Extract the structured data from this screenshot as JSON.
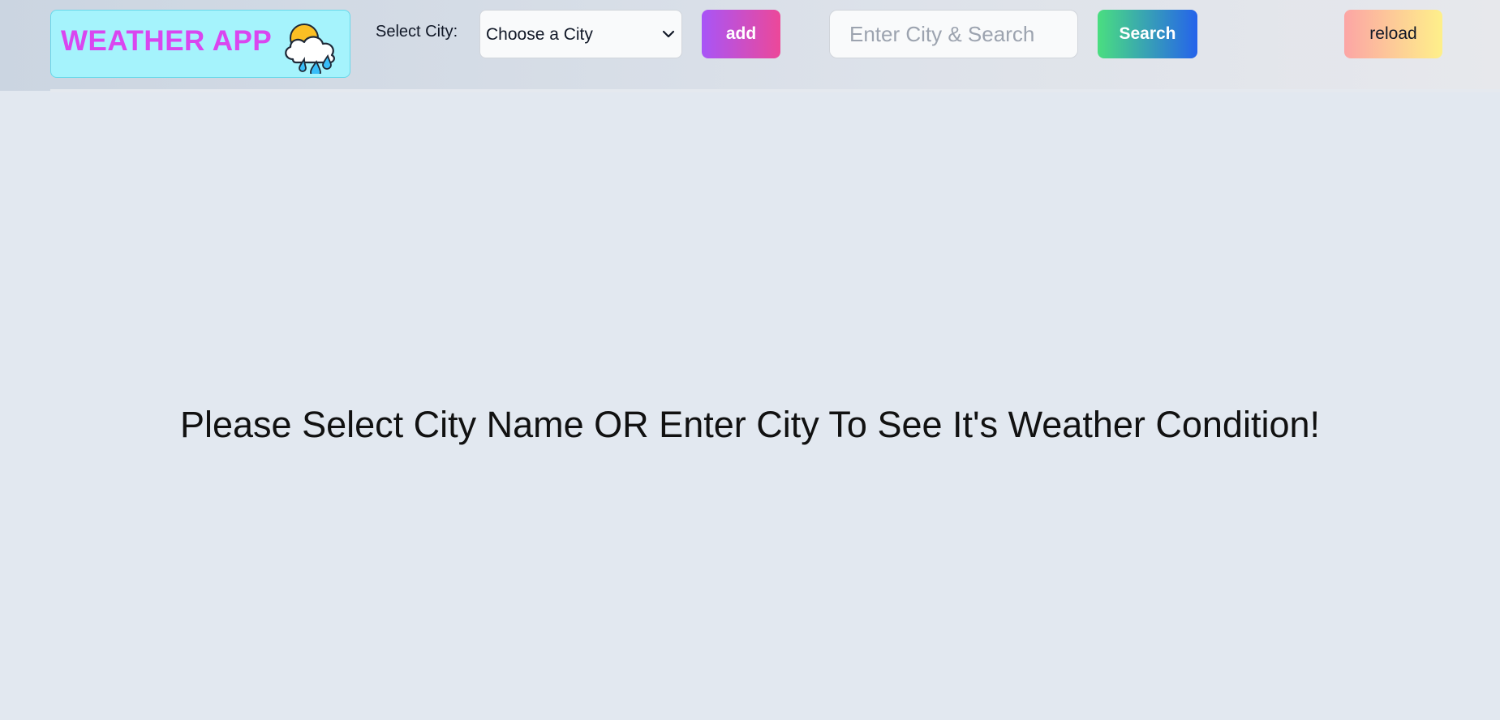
{
  "header": {
    "logo_text": "WEATHER APP",
    "logo_icon": "cloud-rain-sun-icon",
    "select_label": "Select City:",
    "city_select_value": "Choose a City",
    "add_label": "add",
    "search_placeholder": "Enter City & Search",
    "search_label": "Search",
    "reload_label": "reload"
  },
  "main": {
    "message": "Please Select City Name OR Enter City To See It's Weather Condition!"
  },
  "colors": {
    "logo_background": "#a5f3fc",
    "logo_text": "#d946ef",
    "add_gradient": [
      "#a855f7",
      "#ec4899"
    ],
    "search_gradient": [
      "#4ade80",
      "#2563eb"
    ],
    "reload_gradient": [
      "#fca5a5",
      "#fef08a"
    ],
    "page_background": "#e2e8f0"
  }
}
